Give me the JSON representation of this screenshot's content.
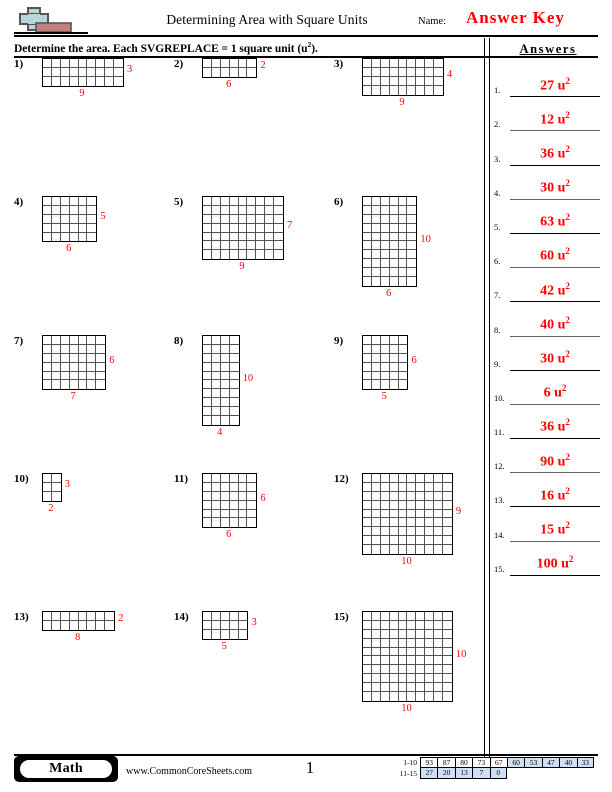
{
  "header": {
    "logo_icon": "plus-block-logo",
    "title": "Determining Area with Square Units",
    "name_label": "Name:",
    "answer_key_label": "Answer Key"
  },
  "instruction": {
    "text_before": "Determine the area. Each SVGREPLACE = 1 square unit (u",
    "superscript": "2",
    "text_after": ")."
  },
  "problems": [
    {
      "number": "1)",
      "width": 9,
      "height": 3,
      "width_label": "9",
      "height_label": "3"
    },
    {
      "number": "2)",
      "width": 6,
      "height": 2,
      "width_label": "6",
      "height_label": "2"
    },
    {
      "number": "3)",
      "width": 9,
      "height": 4,
      "width_label": "9",
      "height_label": "4"
    },
    {
      "number": "4)",
      "width": 6,
      "height": 5,
      "width_label": "6",
      "height_label": "5"
    },
    {
      "number": "5)",
      "width": 9,
      "height": 7,
      "width_label": "9",
      "height_label": "7"
    },
    {
      "number": "6)",
      "width": 6,
      "height": 10,
      "width_label": "6",
      "height_label": "10"
    },
    {
      "number": "7)",
      "width": 7,
      "height": 6,
      "width_label": "7",
      "height_label": "6"
    },
    {
      "number": "8)",
      "width": 4,
      "height": 10,
      "width_label": "4",
      "height_label": "10"
    },
    {
      "number": "9)",
      "width": 5,
      "height": 6,
      "width_label": "5",
      "height_label": "6"
    },
    {
      "number": "10)",
      "width": 2,
      "height": 3,
      "width_label": "2",
      "height_label": "3"
    },
    {
      "number": "11)",
      "width": 6,
      "height": 6,
      "width_label": "6",
      "height_label": "6"
    },
    {
      "number": "12)",
      "width": 10,
      "height": 9,
      "width_label": "10",
      "height_label": "9"
    },
    {
      "number": "13)",
      "width": 8,
      "height": 2,
      "width_label": "8",
      "height_label": "2"
    },
    {
      "number": "14)",
      "width": 5,
      "height": 3,
      "width_label": "5",
      "height_label": "3"
    },
    {
      "number": "15)",
      "width": 10,
      "height": 10,
      "width_label": "10",
      "height_label": "10"
    }
  ],
  "answers": {
    "title": "Answers",
    "items": [
      {
        "num": "1.",
        "value": "27",
        "unit": "u",
        "exp": "2"
      },
      {
        "num": "2.",
        "value": "12",
        "unit": "u",
        "exp": "2"
      },
      {
        "num": "3.",
        "value": "36",
        "unit": "u",
        "exp": "2"
      },
      {
        "num": "4.",
        "value": "30",
        "unit": "u",
        "exp": "2"
      },
      {
        "num": "5.",
        "value": "63",
        "unit": "u",
        "exp": "2"
      },
      {
        "num": "6.",
        "value": "60",
        "unit": "u",
        "exp": "2"
      },
      {
        "num": "7.",
        "value": "42",
        "unit": "u",
        "exp": "2"
      },
      {
        "num": "8.",
        "value": "40",
        "unit": "u",
        "exp": "2"
      },
      {
        "num": "9.",
        "value": "30",
        "unit": "u",
        "exp": "2"
      },
      {
        "num": "10.",
        "value": "6",
        "unit": "u",
        "exp": "2"
      },
      {
        "num": "11.",
        "value": "36",
        "unit": "u",
        "exp": "2"
      },
      {
        "num": "12.",
        "value": "90",
        "unit": "u",
        "exp": "2"
      },
      {
        "num": "13.",
        "value": "16",
        "unit": "u",
        "exp": "2"
      },
      {
        "num": "14.",
        "value": "15",
        "unit": "u",
        "exp": "2"
      },
      {
        "num": "15.",
        "value": "100",
        "unit": "u",
        "exp": "2"
      }
    ]
  },
  "footer": {
    "subject_badge": "Math",
    "site_url": "www.CommonCoreSheets.com",
    "page_number": "1",
    "score_table": {
      "row1_label": "1-10",
      "row1_values": [
        "93",
        "87",
        "80",
        "73",
        "67",
        "60",
        "53",
        "47",
        "40",
        "33"
      ],
      "row1_highlight_from": 5,
      "row2_label": "11-15",
      "row2_values": [
        "27",
        "20",
        "13",
        "7",
        "0"
      ],
      "row2_highlight_from": 0
    }
  },
  "colors": {
    "answer_red": "#ff0000",
    "grid_line": "#555555",
    "grid_border": "#000000",
    "score_highlight": "#cfdff5",
    "logo_blue": "#b5d6da",
    "logo_red": "#c08080"
  }
}
